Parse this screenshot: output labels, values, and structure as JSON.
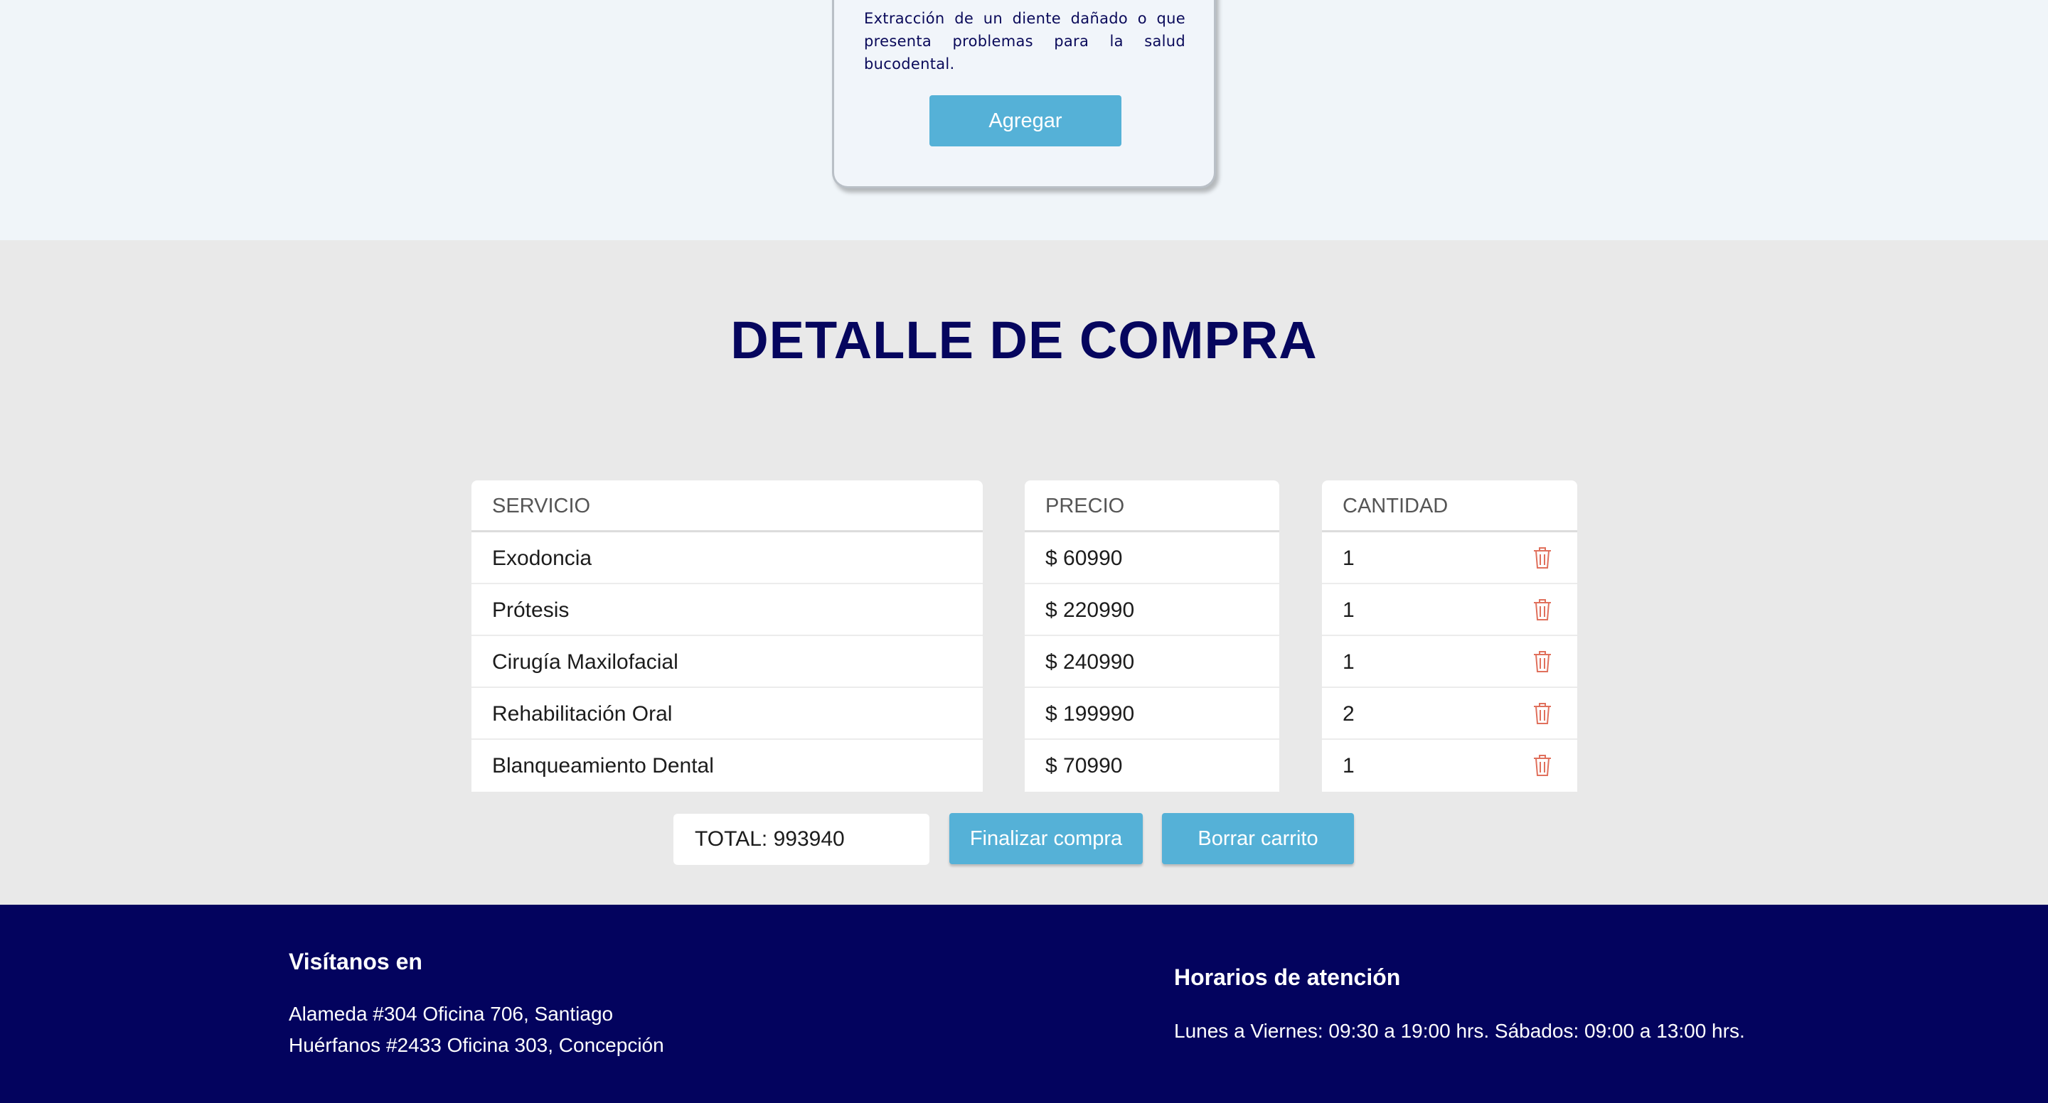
{
  "service_card": {
    "description": "Extracción de un diente dañado o que presenta problemas para la salud bucodental.",
    "add_label": "Agregar"
  },
  "detail": {
    "title": "DETALLE DE COMPRA",
    "headers": {
      "service": "SERVICIO",
      "price": "PRECIO",
      "quantity": "CANTIDAD"
    },
    "rows": [
      {
        "service": "Exodoncia",
        "price": "$ 60990",
        "quantity": "1"
      },
      {
        "service": "Prótesis",
        "price": "$ 220990",
        "quantity": "1"
      },
      {
        "service": "Cirugía Maxilofacial",
        "price": "$ 240990",
        "quantity": "1"
      },
      {
        "service": "Rehabilitación Oral",
        "price": "$ 199990",
        "quantity": "2"
      },
      {
        "service": "Blanqueamiento Dental",
        "price": "$ 70990",
        "quantity": "1"
      }
    ],
    "total": "TOTAL: 993940",
    "finalize_label": "Finalizar compra",
    "clear_label": "Borrar carrito",
    "trash_icon": "trash-icon",
    "trash_color": "#e0705c"
  },
  "footer": {
    "visit_title": "Visítanos en",
    "address_1": "Alameda #304 Oficina 706, Santiago",
    "address_2": "Huérfanos #2433 Oficina 303, Concepción",
    "hours_title": "Horarios de atención",
    "hours_text": "Lunes a Viernes: 09:30 a 19:00 hrs. Sábados: 09:00 a 13:00 hrs."
  },
  "colors": {
    "accent": "#55b1d7",
    "navy": "#03035e",
    "title": "#06065e"
  }
}
